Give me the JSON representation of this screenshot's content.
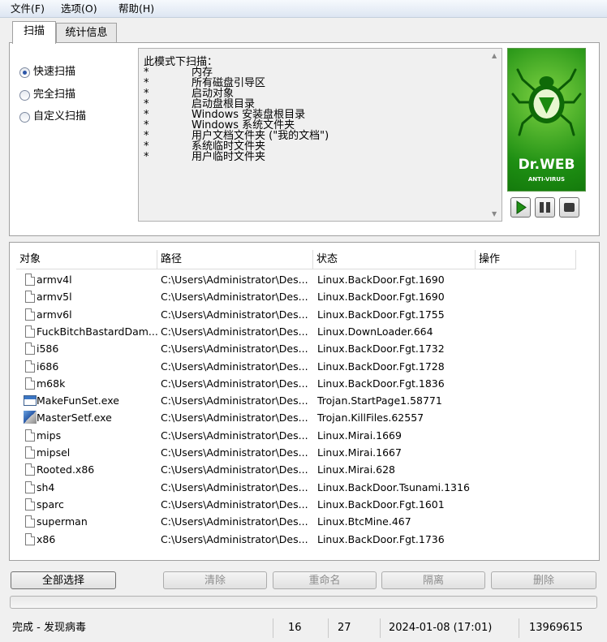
{
  "menu": [
    "文件(F)",
    "选项(O)",
    "帮助(H)"
  ],
  "tabs": [
    "扫描",
    "统计信息"
  ],
  "scan_modes": [
    {
      "label": "快速扫描",
      "selected": true
    },
    {
      "label": "完全扫描",
      "selected": false
    },
    {
      "label": "自定义扫描",
      "selected": false
    }
  ],
  "description": {
    "title": "此模式下扫描：",
    "items": [
      "内存",
      "所有磁盘引导区",
      "启动对象",
      "启动盘根目录",
      "Windows 安装盘根目录",
      "Windows 系统文件夹",
      "用户文档文件夹 (\"我的文档\")",
      "系统临时文件夹",
      "用户临时文件夹"
    ]
  },
  "logo": {
    "brand": "Dr.WEB",
    "sub": "ANTI-VIRUS"
  },
  "controls": {
    "play_icon": "play-icon",
    "pause_icon": "pause-icon",
    "stop_icon": "stop-icon"
  },
  "columns": [
    "对象",
    "路径",
    "状态",
    "操作"
  ],
  "rows": [
    {
      "name": "armv4l",
      "path": "C:\\Users\\Administrator\\Des...",
      "status": "Linux.BackDoor.Fgt.1690",
      "icon": "file-icon"
    },
    {
      "name": "armv5l",
      "path": "C:\\Users\\Administrator\\Des...",
      "status": "Linux.BackDoor.Fgt.1690",
      "icon": "file-icon"
    },
    {
      "name": "armv6l",
      "path": "C:\\Users\\Administrator\\Des...",
      "status": "Linux.BackDoor.Fgt.1755",
      "icon": "file-icon"
    },
    {
      "name": "FuckBitchBastardDam...",
      "path": "C:\\Users\\Administrator\\Des...",
      "status": "Linux.DownLoader.664",
      "icon": "file-icon"
    },
    {
      "name": "i586",
      "path": "C:\\Users\\Administrator\\Des...",
      "status": "Linux.BackDoor.Fgt.1732",
      "icon": "file-icon"
    },
    {
      "name": "i686",
      "path": "C:\\Users\\Administrator\\Des...",
      "status": "Linux.BackDoor.Fgt.1728",
      "icon": "file-icon"
    },
    {
      "name": "m68k",
      "path": "C:\\Users\\Administrator\\Des...",
      "status": "Linux.BackDoor.Fgt.1836",
      "icon": "file-icon"
    },
    {
      "name": "MakeFunSet.exe",
      "path": "C:\\Users\\Administrator\\Des...",
      "status": "Trojan.StartPage1.58771",
      "icon": "exe-icon"
    },
    {
      "name": "MasterSetf.exe",
      "path": "C:\\Users\\Administrator\\Des...",
      "status": "Trojan.KillFiles.62557",
      "icon": "setup-icon"
    },
    {
      "name": "mips",
      "path": "C:\\Users\\Administrator\\Des...",
      "status": "Linux.Mirai.1669",
      "icon": "file-icon"
    },
    {
      "name": "mipsel",
      "path": "C:\\Users\\Administrator\\Des...",
      "status": "Linux.Mirai.1667",
      "icon": "file-icon"
    },
    {
      "name": "Rooted.x86",
      "path": "C:\\Users\\Administrator\\Des...",
      "status": "Linux.Mirai.628",
      "icon": "file-icon"
    },
    {
      "name": "sh4",
      "path": "C:\\Users\\Administrator\\Des...",
      "status": "Linux.BackDoor.Tsunami.1316",
      "icon": "file-icon"
    },
    {
      "name": "sparc",
      "path": "C:\\Users\\Administrator\\Des...",
      "status": "Linux.BackDoor.Fgt.1601",
      "icon": "file-icon"
    },
    {
      "name": "superman",
      "path": "C:\\Users\\Administrator\\Des...",
      "status": "Linux.BtcMine.467",
      "icon": "file-icon"
    },
    {
      "name": "x86",
      "path": "C:\\Users\\Administrator\\Des...",
      "status": "Linux.BackDoor.Fgt.1736",
      "icon": "file-icon"
    }
  ],
  "buttons": {
    "select_all": "全部选择",
    "clear": "清除",
    "rename": "重命名",
    "quarantine": "隔离",
    "delete": "删除"
  },
  "status": {
    "text": "完成 - 发现病毒",
    "count1": "16",
    "count2": "27",
    "datetime": "2024-01-08 (17:01)",
    "db_records": "13969615"
  },
  "colors": {
    "logo_green": "#2a9d1a",
    "radio_blue": "#2c56a8"
  }
}
